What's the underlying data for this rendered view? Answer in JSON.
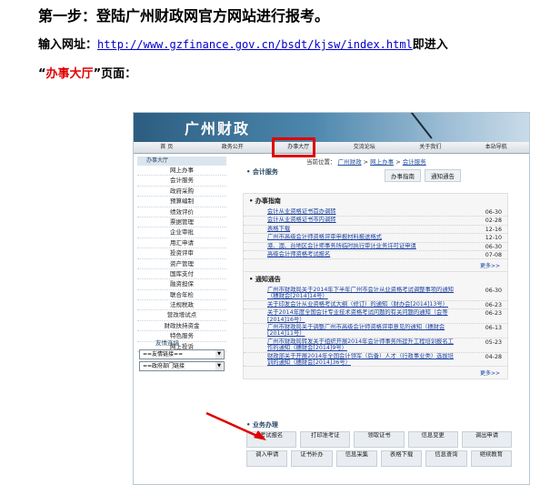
{
  "doc": {
    "heading": "第一步：登陆广州财政网官方网站进行报考。",
    "input_label": "输入网址：",
    "url": "http://www.gzfinance.gov.cn/bsdt/kjsw/index.html",
    "after_url": "即进入",
    "quote_open": "“",
    "quote_red": "办事大厅",
    "quote_close": "”页面："
  },
  "site": {
    "banner_title": "广州财政",
    "nav": [
      "首 页",
      "政务公开",
      "办事大厅",
      "交流论坛",
      "关于我们",
      "本站导航"
    ],
    "sidebar_head": "办事大厅",
    "sidebar": [
      "网上办事",
      "会计服务",
      "政府采购",
      "预算编制",
      "绩效评价",
      "票据管理",
      "企业审批",
      "用汇申请",
      "投资评审",
      "资产管理",
      "国库支付",
      "融资担保",
      "联合年检",
      "法规税政",
      "营改增试点",
      "财政扶持资金",
      "特色服务",
      "网上投诉"
    ],
    "links_head": "友情连接",
    "select1": "==友情链接==",
    "select2": "==政府部门链接",
    "breadcrumb_prefix": "当前位置：",
    "breadcrumb": [
      "广州财政",
      "网上办事",
      "会计服务"
    ],
    "section_title": "会计服务",
    "tabs": [
      "办事指南",
      "通知通告"
    ],
    "guide_head": "办事指南",
    "guide": [
      {
        "t": "会计从业资格证书首办调转",
        "d": "06-30"
      },
      {
        "t": "会计从业资格证书市内调转",
        "d": "02-28"
      },
      {
        "t": "表格下载",
        "d": "12-16"
      },
      {
        "t": "广州市高级会计师资格评审申报材料报送格式",
        "d": "12-10"
      },
      {
        "t": "港、澳、台地区会计师事务所临时执行审计业务许可证申请",
        "d": "06-30"
      },
      {
        "t": "高级会计师资格考试报名",
        "d": "07-08"
      }
    ],
    "more": "更多>>",
    "notice_head": "通知通告",
    "notices": [
      {
        "t": "广州市财政局关于2014年下半年广州市会计从业资格考试调整事项的通知（穗财会[2014]14号）",
        "d": "06-30"
      },
      {
        "t": "关于印发会计从业资格考试大纲（修订）的通知（财办会[2014]13号）",
        "d": "06-23"
      },
      {
        "t": "关于2014年度全国会计专业技术资格考试问题的有关问题的通知（会等[2014]16号）",
        "d": "06-23"
      },
      {
        "t": "广州市财政局关于调整广州市高级会计师资格评审意见的通知（穗财会[2014]11号）",
        "d": "06-13"
      },
      {
        "t": "广州市财政局转发关于组织开展2014年会计师事务所提升工程培训报名工作的通知（穗财会[2014]9号）",
        "d": "05-23"
      },
      {
        "t": "财政部关于开展2014年全国会计领军（后备）人才（行政事业类）选拔培训的通知（穗财会[2014]36号）",
        "d": "04-28"
      }
    ],
    "biz_title": "业务办理",
    "biz_row1": [
      "考试报名",
      "打印准考证",
      "领取证书",
      "信息变更",
      "调出申请"
    ],
    "biz_row2": [
      "调入申请",
      "证书补办",
      "信息采集",
      "表格下载",
      "信息查询",
      "继续教育"
    ]
  }
}
